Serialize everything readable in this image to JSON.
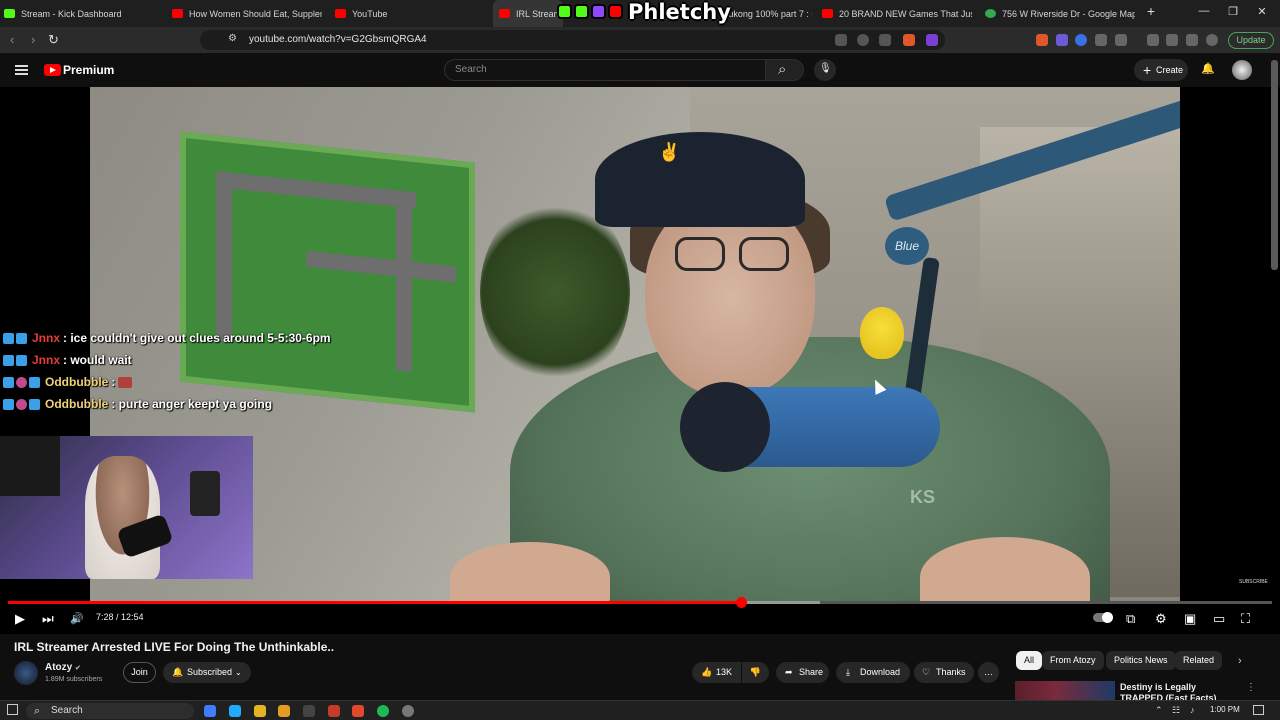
{
  "browser": {
    "tabs": [
      {
        "label": "Stream - Kick Dashboard",
        "favicon_color": "#53fc18"
      },
      {
        "label": "How Women Should Eat, Supplemen",
        "favicon_color": "#ff0000"
      },
      {
        "label": "YouTube",
        "favicon_color": "#ff0000"
      },
      {
        "label": "IRL Streamer",
        "favicon_color": "#ff0000"
      },
      {
        "label": "Wukong 100% part 7 : Ch",
        "favicon_color": "#ff0000"
      },
      {
        "label": "20 BRAND NEW Games That Just Ge",
        "favicon_color": "#ff0000"
      },
      {
        "label": "756 W Riverside Dr - Google Maps",
        "favicon_color": "#34a853"
      }
    ],
    "new_tab_icon": "+",
    "window_controls": [
      "—",
      "❐",
      "✕"
    ],
    "nav": {
      "back_icon": "‹",
      "forward_icon": "›",
      "reload_icon": "↻",
      "bookmark_icon": "☐",
      "site_info_icon": "⚙"
    },
    "url": "youtube.com/watch?v=G2GbsmQRGA4",
    "update_label": "Update"
  },
  "overlay": {
    "brand_text": "Phletchy",
    "icon_colors": [
      "#53fc18",
      "#53fc18",
      "#9146ff",
      "#ff0000"
    ]
  },
  "youtube_header": {
    "brand": "Premium",
    "search_placeholder": "Search",
    "create_label": "Create",
    "search_icon": "⌕",
    "mic_icon": "🎙",
    "bell_icon": "🔔"
  },
  "chat": [
    {
      "name": "Jnnx",
      "name_color": "#e53b3b",
      "message": ": ice couldn't give out clues around 5-5:30-6pm"
    },
    {
      "name": "Jnnx",
      "name_color": "#e53b3b",
      "message": ": would wait"
    },
    {
      "name": "Oddbubble",
      "name_color": "#f0d27a",
      "message": ": "
    },
    {
      "name": "Oddbubble",
      "name_color": "#f0d27a",
      "message": ": purte anger keept ya going"
    }
  ],
  "video": {
    "cap_logo": "✌",
    "mic_brand": "Blue",
    "watermark": "SUBSCRIBE",
    "hoodie_text": "KS",
    "elapsed": "7:28",
    "duration": "12:54",
    "timecode": "7:28 / 12:54",
    "progress_fraction": 0.58,
    "controls": {
      "play_icon": "▶",
      "next_icon": "⏭",
      "volume_icon": "🔊",
      "captions_icon": "⧉",
      "settings_icon": "⚙",
      "miniplayer_icon": "▣",
      "theater_icon": "▭",
      "fullscreen_icon": "⛶"
    }
  },
  "details": {
    "title": "IRL Streamer Arrested LIVE For Doing The Unthinkable..",
    "channel": "Atozy",
    "verified_icon": "✔",
    "subscribers": "1.89M subscribers",
    "join_label": "Join",
    "subscribed_label": "Subscribed",
    "like_count": "13K",
    "share_label": "Share",
    "download_label": "Download",
    "thanks_label": "Thanks",
    "more_icon": "…"
  },
  "chips": [
    {
      "label": "All",
      "selected": true
    },
    {
      "label": "From Atozy",
      "selected": false
    },
    {
      "label": "Politics News",
      "selected": false
    },
    {
      "label": "Related",
      "selected": false
    }
  ],
  "recommendation": {
    "title": "Destiny is Legally TRAPPED (East Facts)"
  },
  "taskbar": {
    "search_label": "Search",
    "time": "1:00 PM",
    "app_colors": [
      "#3f7cff",
      "#22aaff",
      "#e6b422",
      "#e69b22",
      "#444444",
      "#c43b2a",
      "#e04a2a",
      "#1db954",
      "#777777"
    ]
  }
}
